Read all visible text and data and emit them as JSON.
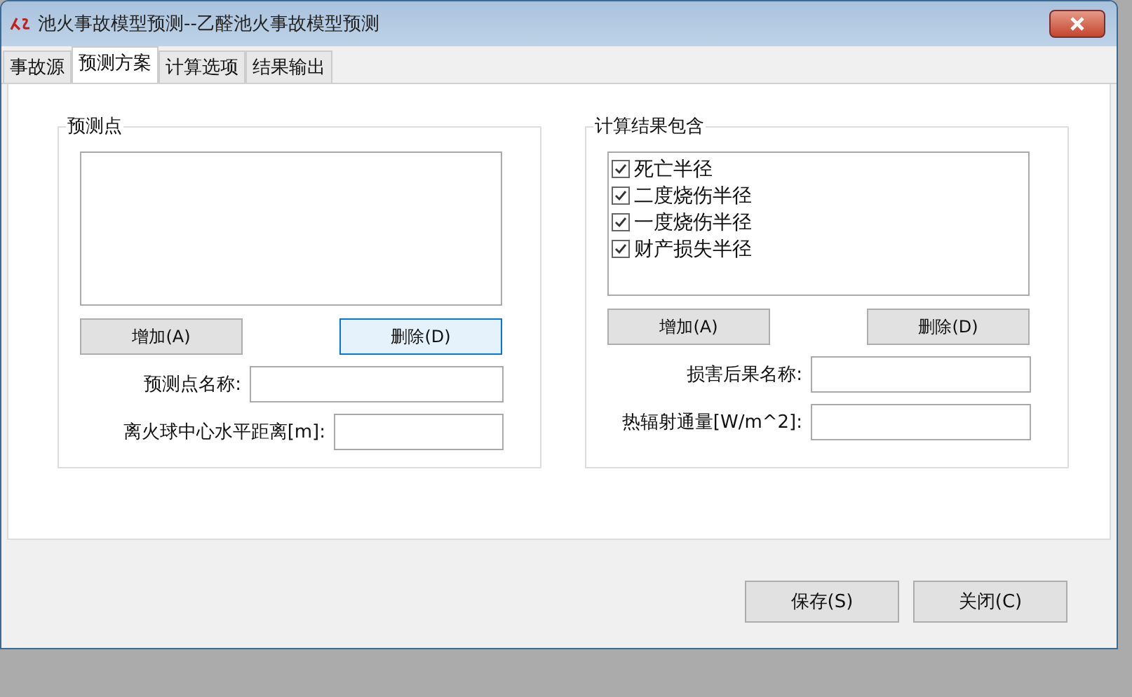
{
  "window": {
    "title": "池火事故模型预测--乙醛池火事故模型预测"
  },
  "tabs": [
    {
      "label": "事故源",
      "selected": false
    },
    {
      "label": "预测方案",
      "selected": true
    },
    {
      "label": "计算选项",
      "selected": false
    },
    {
      "label": "结果输出",
      "selected": false
    }
  ],
  "groups": [
    {
      "title": "预测点",
      "buttons": [
        {
          "label": "增加(A)",
          "focused": false
        },
        {
          "label": "删除(D)",
          "focused": true
        }
      ],
      "fields": [
        {
          "label": "预测点名称:"
        },
        {
          "label": "离火球中心水平距离[m]:"
        }
      ]
    },
    {
      "title": "计算结果包含",
      "items": [
        {
          "label": "死亡半径",
          "checked": true
        },
        {
          "label": "二度烧伤半径",
          "checked": true
        },
        {
          "label": "一度烧伤半径",
          "checked": true
        },
        {
          "label": "财产损失半径",
          "checked": true
        }
      ],
      "buttons": [
        {
          "label": "增加(A)",
          "focused": false
        },
        {
          "label": "删除(D)",
          "focused": false
        }
      ],
      "fields": [
        {
          "label": "损害后果名称:"
        },
        {
          "label": "热辐射通量[W/m^2]:"
        }
      ]
    }
  ],
  "footer_buttons": [
    {
      "label": "保存(S)"
    },
    {
      "label": "关闭(C)"
    }
  ]
}
